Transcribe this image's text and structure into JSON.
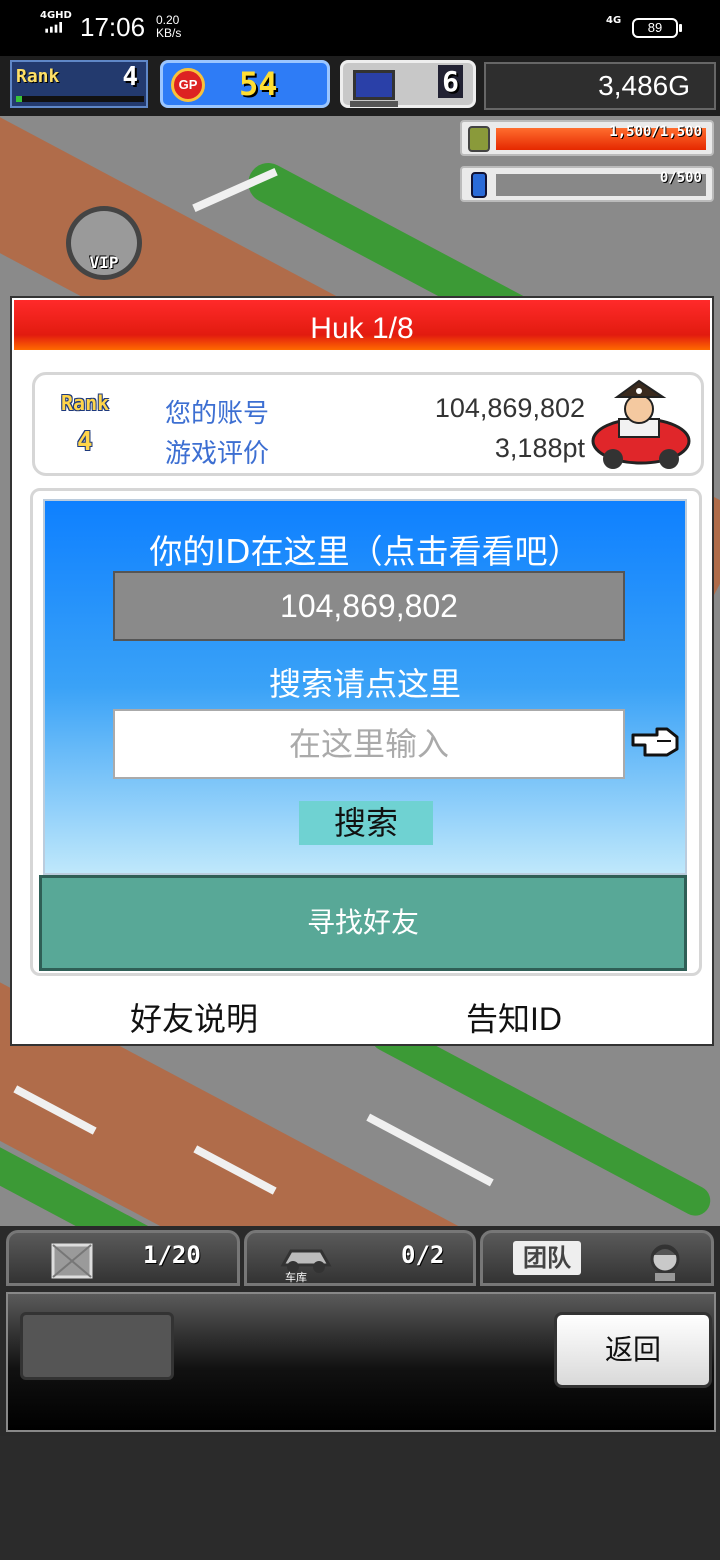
{
  "status_bar": {
    "network": "4GHD",
    "time": "17:06",
    "speed_value": "0.20",
    "speed_unit": "KB/s",
    "network_right": "4G",
    "battery": "89"
  },
  "hud": {
    "rank_label": "Rank",
    "rank_value": "4",
    "rank_progress": 0.05,
    "gp_label": "GP",
    "gp_value": "54",
    "pc_value": "6",
    "gold": "3,486G",
    "resource1": {
      "text": "1,500/1,500",
      "fill": 1.0
    },
    "resource2": {
      "text": "0/500",
      "fill": 0.0
    },
    "vip_label": "VIP"
  },
  "dialog": {
    "title": "Huk 1/8",
    "profile": {
      "rank_label": "Rank",
      "rank_value": "4",
      "account_label": "您的账号",
      "account_value": "104,869,802",
      "rating_label": "游戏评价",
      "rating_value": "3,188pt"
    },
    "search": {
      "id_heading": "你的ID在这里（点击看看吧）",
      "id_value": "104,869,802",
      "search_prompt": "搜索请点这里",
      "input_placeholder": "在这里输入",
      "search_button": "搜索"
    },
    "find_friend_button": "寻找好友",
    "friend_help_link": "好友说明",
    "share_id_link": "告知ID"
  },
  "bottom": {
    "tab1_count": "1/20",
    "tab2_label": "车库",
    "tab2_count": "0/2",
    "tab3_label": "团队",
    "back_button": "返回"
  },
  "colors": {
    "title_red": "#e21b0f",
    "label_blue": "#3d6fd2",
    "find_friend_green": "#58a897",
    "search_button_cyan": "#6fd2d2"
  }
}
